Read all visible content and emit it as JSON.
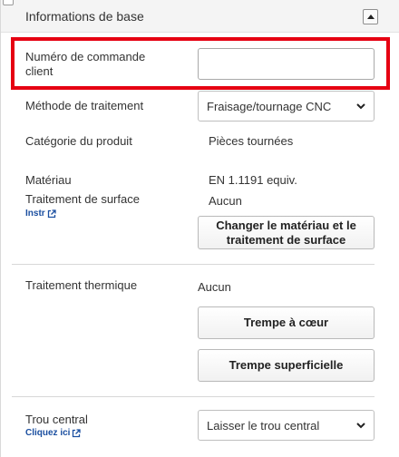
{
  "section": {
    "title": "Informations de base"
  },
  "fields": {
    "order_number": {
      "label": "Numéro de commande client",
      "value": "",
      "placeholder": ""
    },
    "process_method": {
      "label": "Méthode de traitement",
      "value": "Fraisage/tournage CNC"
    },
    "product_category": {
      "label": "Catégorie du produit",
      "value": "Pièces tournées"
    },
    "material": {
      "label": "Matériau",
      "value": "EN 1.1191 equiv."
    },
    "surface_treatment": {
      "label": "Traitement de surface",
      "value": "Aucun",
      "link": "Instr"
    },
    "change_material_button": "Changer le matériau et le traitement de surface",
    "heat_treatment": {
      "label": "Traitement thermique",
      "value": "Aucun"
    },
    "quench_core_button": "Trempe à cœur",
    "quench_surface_button": "Trempe superficielle",
    "center_hole": {
      "label": "Trou central",
      "link": "Cliquez ici",
      "value": "Laisser le trou central"
    }
  },
  "colors": {
    "highlight": "#e60012",
    "link": "#1b4fa0"
  }
}
